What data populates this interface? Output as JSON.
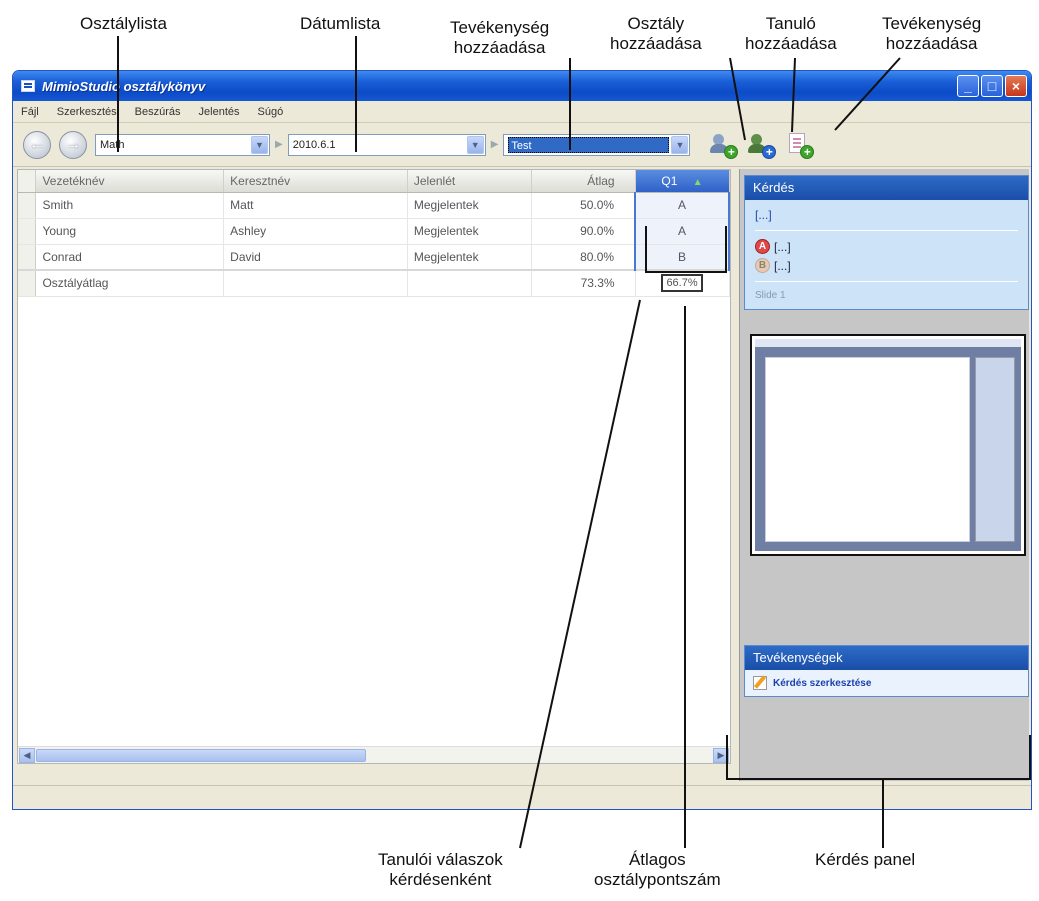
{
  "annotations": {
    "class_list": "Osztálylista",
    "date_list": "Dátumlista",
    "add_activity_1": [
      "Tevékenység",
      "hozzáadása"
    ],
    "add_class": [
      "Osztály",
      "hozzáadása"
    ],
    "add_student": [
      "Tanuló",
      "hozzáadása"
    ],
    "add_activity_2": [
      "Tevékenység",
      "hozzáadása"
    ],
    "student_answers": [
      "Tanulói válaszok",
      "kérdésenként"
    ],
    "avg_class_score": [
      "Átlagos",
      "osztálypontszám"
    ],
    "question_panel": "Kérdés panel"
  },
  "window": {
    "title": "MimioStudio osztálykönyv",
    "menu": [
      "Fájl",
      "Szerkesztés",
      "Beszúrás",
      "Jelentés",
      "Súgó"
    ]
  },
  "toolbar": {
    "class_value": "Math",
    "date_value": "2010.6.1",
    "activity_value": "Test"
  },
  "grid": {
    "headers": [
      "Vezetéknév",
      "Keresztnév",
      "Jelenlét",
      "Átlag",
      "Q1"
    ],
    "rows": [
      {
        "last": "Smith",
        "first": "Matt",
        "presence": "Megjelentek",
        "avg": "50.0%",
        "q1": "A"
      },
      {
        "last": "Young",
        "first": "Ashley",
        "presence": "Megjelentek",
        "avg": "90.0%",
        "q1": "A"
      },
      {
        "last": "Conrad",
        "first": "David",
        "presence": "Megjelentek",
        "avg": "80.0%",
        "q1": "B"
      }
    ],
    "avg_row": {
      "label": "Osztályátlag",
      "avg": "73.3%",
      "q1": "66.7%"
    }
  },
  "panel": {
    "question_header": "Kérdés",
    "question_text": "[...]",
    "option_a": "[...]",
    "option_b": "[...]",
    "page_label": "Slide 1",
    "activities_header": "Tevékenységek",
    "activity_link": "Kérdés szerkesztése"
  },
  "colors": {
    "title_blue": "#1a5fd8",
    "panel_header": "#2d6bc8",
    "add_green": "#3da62a"
  }
}
